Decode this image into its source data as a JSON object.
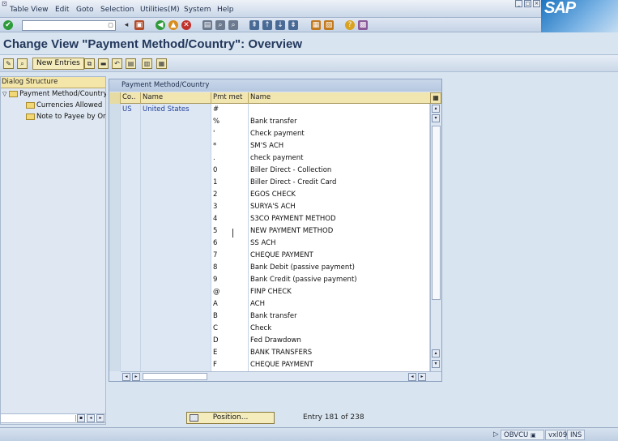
{
  "menu": {
    "items": [
      "Table View",
      "Edit",
      "Goto",
      "Selection",
      "Utilities(M)",
      "System",
      "Help"
    ]
  },
  "brand": {
    "logo_text": "SAP"
  },
  "title": "Change View \"Payment Method/Country\": Overview",
  "app_toolbar": {
    "new_entries_label": "New Entries"
  },
  "dialog_structure": {
    "header": "Dialog Structure",
    "items": [
      {
        "label": "Payment Method/Country",
        "level": 0,
        "open": true
      },
      {
        "label": "Currencies Allowed",
        "level": 1
      },
      {
        "label": "Note to Payee by Orig",
        "level": 1
      }
    ]
  },
  "table": {
    "caption": "Payment Method/Country",
    "columns": [
      "Co..",
      "Name",
      "Pmt met",
      "Name"
    ],
    "rows": [
      {
        "co": "US",
        "name": "United States",
        "pm": "#",
        "pm_name": ""
      },
      {
        "co": "",
        "name": "",
        "pm": "%",
        "pm_name": "Bank transfer"
      },
      {
        "co": "",
        "name": "",
        "pm": "'",
        "pm_name": "Check payment"
      },
      {
        "co": "",
        "name": "",
        "pm": "*",
        "pm_name": "SM'S ACH"
      },
      {
        "co": "",
        "name": "",
        "pm": ".",
        "pm_name": "check payment"
      },
      {
        "co": "",
        "name": "",
        "pm": "0",
        "pm_name": "Biller Direct - Collection"
      },
      {
        "co": "",
        "name": "",
        "pm": "1",
        "pm_name": "Biller Direct - Credit Card"
      },
      {
        "co": "",
        "name": "",
        "pm": "2",
        "pm_name": "EGOS CHECK"
      },
      {
        "co": "",
        "name": "",
        "pm": "3",
        "pm_name": "SURYA'S ACH"
      },
      {
        "co": "",
        "name": "",
        "pm": "4",
        "pm_name": "S3CO PAYMENT METHOD"
      },
      {
        "co": "",
        "name": "",
        "pm": "5",
        "pm_name": "NEW PAYMENT METHOD"
      },
      {
        "co": "",
        "name": "",
        "pm": "6",
        "pm_name": "SS ACH"
      },
      {
        "co": "",
        "name": "",
        "pm": "7",
        "pm_name": "CHEQUE PAYMENT"
      },
      {
        "co": "",
        "name": "",
        "pm": "8",
        "pm_name": "Bank Debit (passive payment)"
      },
      {
        "co": "",
        "name": "",
        "pm": "9",
        "pm_name": "Bank Credit (passive payment)"
      },
      {
        "co": "",
        "name": "",
        "pm": "@",
        "pm_name": "FINP CHECK"
      },
      {
        "co": "",
        "name": "",
        "pm": "A",
        "pm_name": "ACH"
      },
      {
        "co": "",
        "name": "",
        "pm": "B",
        "pm_name": "Bank transfer"
      },
      {
        "co": "",
        "name": "",
        "pm": "C",
        "pm_name": "Check"
      },
      {
        "co": "",
        "name": "",
        "pm": "D",
        "pm_name": "Fed Drawdown"
      },
      {
        "co": "",
        "name": "",
        "pm": "E",
        "pm_name": "BANK TRANSFERS"
      },
      {
        "co": "",
        "name": "",
        "pm": "F",
        "pm_name": "CHEQUE PAYMENT"
      }
    ]
  },
  "position": {
    "button_label": "Position...",
    "entry_text": "Entry 181 of 238"
  },
  "statusbar": {
    "transaction": "OBVCU",
    "server": "vxl09",
    "mode": "INS"
  }
}
